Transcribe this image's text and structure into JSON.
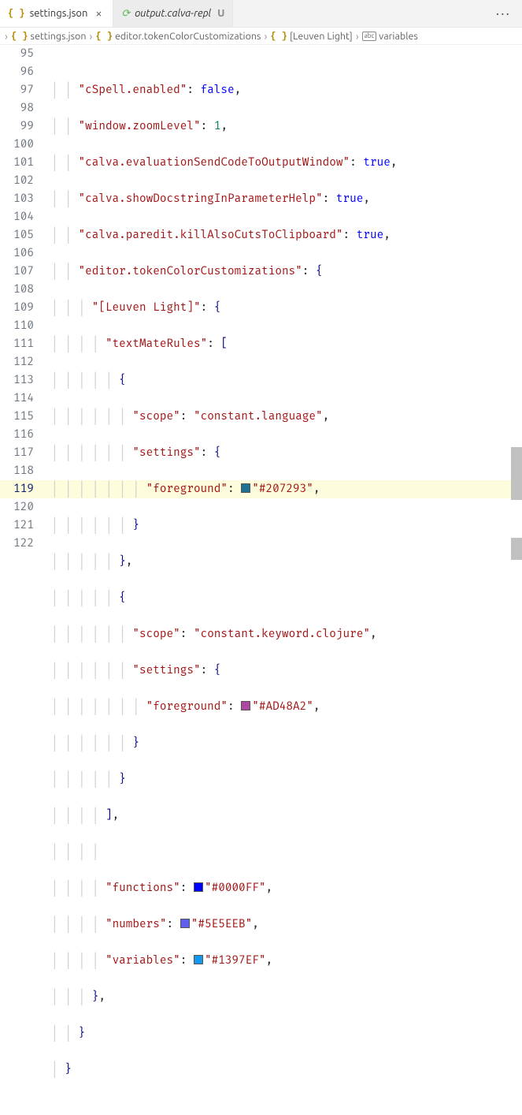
{
  "tabs": [
    {
      "icon": "{ }",
      "label": "settings.json",
      "active": true,
      "close": "×"
    },
    {
      "icon": "⟳",
      "label": "output.calva-repl",
      "active": false,
      "modified": "U"
    }
  ],
  "tab_actions": "···",
  "breadcrumbs": [
    {
      "icon": "{ }",
      "label": "settings.json"
    },
    {
      "icon": "{ }",
      "label": "editor.tokenColorCustomizations"
    },
    {
      "icon": "{ }",
      "label": "[Leuven Light]"
    },
    {
      "icon": "abc",
      "label": "variables"
    }
  ],
  "keys": {
    "cspell": "cSpell.enabled",
    "zoom": "window.zoomLevel",
    "calvaEval": "calva.evaluationSendCodeToOutputWindow",
    "calvaDoc": "calva.showDocstringInParameterHelp",
    "calvaPared": "calva.paredit.killAlsoCutsToClipboard",
    "tokenColor": "editor.tokenColorCustomizations",
    "leuven": "[Leuven Light]",
    "textMate": "textMateRules",
    "scope": "scope",
    "settings": "settings",
    "foreground": "foreground",
    "functions": "functions",
    "numbers": "numbers",
    "variables": "variables"
  },
  "vals": {
    "false": "false",
    "true": "true",
    "one": "1",
    "constLang": "constant.language",
    "constKwClj": "constant.keyword.clojure",
    "c207293": "#207293",
    "cAD48A2": "#AD48A2",
    "c0000FF": "#0000FF",
    "c5E5EEB": "#5E5EEB",
    "c1397EF": "#1397EF"
  },
  "swatches": {
    "c207293": "#207293",
    "cAD48A2": "#AD48A2",
    "c0000FF": "#0000FF",
    "c5E5EEB": "#5E5EEB",
    "c1397EF": "#1397EF"
  },
  "line_start": 95,
  "line_count": 28,
  "current_line": 119
}
